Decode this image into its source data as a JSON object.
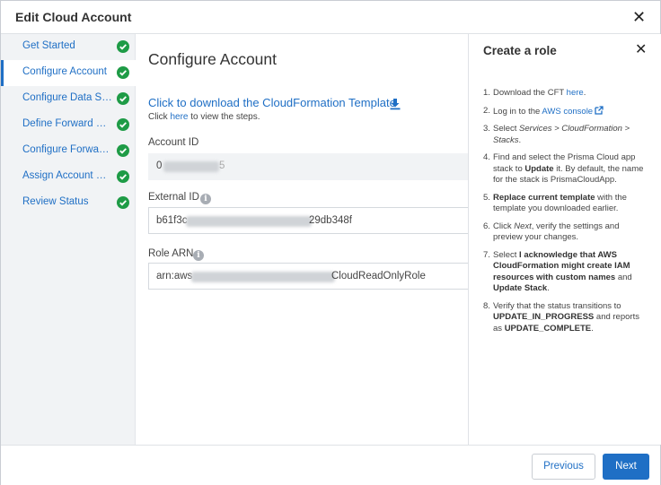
{
  "dialog": {
    "title": "Edit Cloud Account"
  },
  "sidebar": {
    "items": [
      {
        "label": "Get Started",
        "active": false
      },
      {
        "label": "Configure Account",
        "active": true
      },
      {
        "label": "Configure Data Security",
        "active": false
      },
      {
        "label": "Define Forward Scan",
        "active": false
      },
      {
        "label": "Configure Forward Scan",
        "active": false
      },
      {
        "label": "Assign Account Groups",
        "active": false
      },
      {
        "label": "Review Status",
        "active": false
      }
    ]
  },
  "main": {
    "title": "Configure Account",
    "cft_link": "Click to download the CloudFormation Template",
    "steps_prefix": "Click",
    "steps_link": "here",
    "steps_suffix": "to view the steps.",
    "account_id": {
      "label": "Account ID",
      "value_start": "0",
      "value_end": "5"
    },
    "external_id": {
      "label": "External ID",
      "value_start": "b61f3c",
      "value_end": "29db348f"
    },
    "role_arn": {
      "label": "Role ARN",
      "value_start": "arn:aws",
      "value_end": "CloudReadOnlyRole"
    }
  },
  "panel": {
    "title": "Create a role",
    "steps": [
      {
        "num": "1.",
        "a": "Download the CFT",
        "link": "here",
        "b": "."
      },
      {
        "num": "2.",
        "a": "Log in to the",
        "link": "AWS console",
        "b": ""
      },
      {
        "num": "3.",
        "a": "Select",
        "i": "Services > CloudFormation > Stacks",
        "b": "."
      },
      {
        "num": "4.",
        "a": "Find and select the Prisma Cloud app stack to",
        "bold": "Update",
        "b": "it. By default, the name for the stack is PrismaCloudApp."
      },
      {
        "num": "5.",
        "bold": "Replace current template",
        "b": "with the template you downloaded earlier."
      },
      {
        "num": "6.",
        "a": "Click",
        "i": "Next",
        "b": ", verify the settings and preview your changes."
      },
      {
        "num": "7.",
        "a": "Select",
        "bold": "I acknowledge that AWS CloudFormation might create IAM resources with custom names",
        "b": "and",
        "bold2": "Update Stack",
        "c": "."
      },
      {
        "num": "8.",
        "a": "Verify that the status transitions to",
        "bold": "UPDATE_IN_PROGRESS",
        "b": "and reports as",
        "bold2": "UPDATE_COMPLETE",
        "c": "."
      }
    ]
  },
  "footer": {
    "previous_label": "Previous",
    "next_label": "Next"
  },
  "colors": {
    "accent": "#1f6fc5",
    "success": "#1e9b46",
    "sidebar_bg": "#f1f3f5"
  }
}
